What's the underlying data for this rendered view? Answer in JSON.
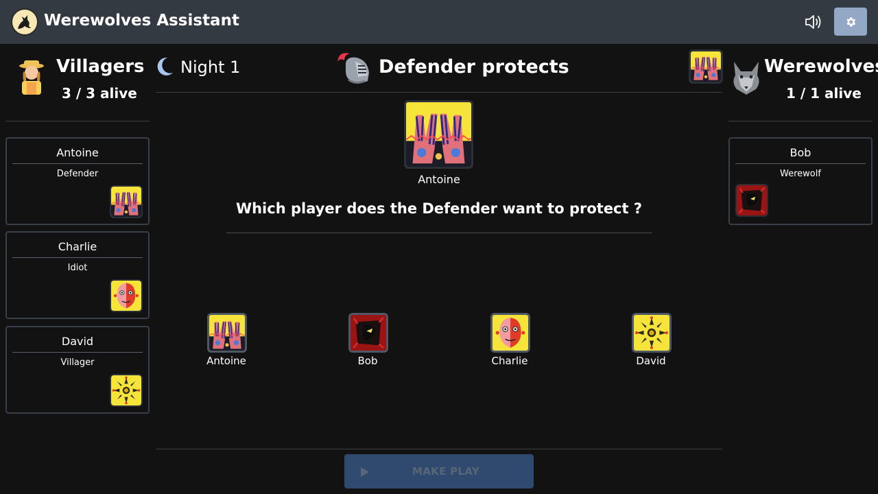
{
  "header": {
    "app_title": "Werewolves Assistant",
    "sound_icon": "speaker-volume-icon",
    "settings_icon": "gear-icon"
  },
  "villagers": {
    "title": "Villagers",
    "alive": "3 / 3 alive",
    "players": [
      {
        "name": "Antoine",
        "role": "Defender",
        "icon": "defender-role-icon"
      },
      {
        "name": "Charlie",
        "role": "Idiot",
        "icon": "idiot-role-icon"
      },
      {
        "name": "David",
        "role": "Villager",
        "icon": "villager-role-icon"
      }
    ]
  },
  "werewolves": {
    "title": "Werewolves",
    "alive": "1 / 1 alive",
    "players": [
      {
        "name": "Bob",
        "role": "Werewolf",
        "icon": "werewolf-role-icon"
      }
    ]
  },
  "phase": {
    "label": "Night 1",
    "icon": "moon-icon",
    "step_title": "Defender protects",
    "step_icon": "knight-helmet-icon"
  },
  "main": {
    "acting_player": "Antoine",
    "question": "Which player does the Defender want to protect ?",
    "targets": [
      {
        "name": "Antoine",
        "icon": "defender-role-icon"
      },
      {
        "name": "Bob",
        "icon": "werewolf-role-icon"
      },
      {
        "name": "Charlie",
        "icon": "idiot-role-icon"
      },
      {
        "name": "David",
        "icon": "villager-role-icon"
      }
    ],
    "make_play_label": "MAKE PLAY"
  },
  "colors": {
    "background": "#121212",
    "header": "#343a42",
    "settings_button": "#93a8c5",
    "make_play_button": "#2f4a6e",
    "card_border": "#3a404a"
  }
}
